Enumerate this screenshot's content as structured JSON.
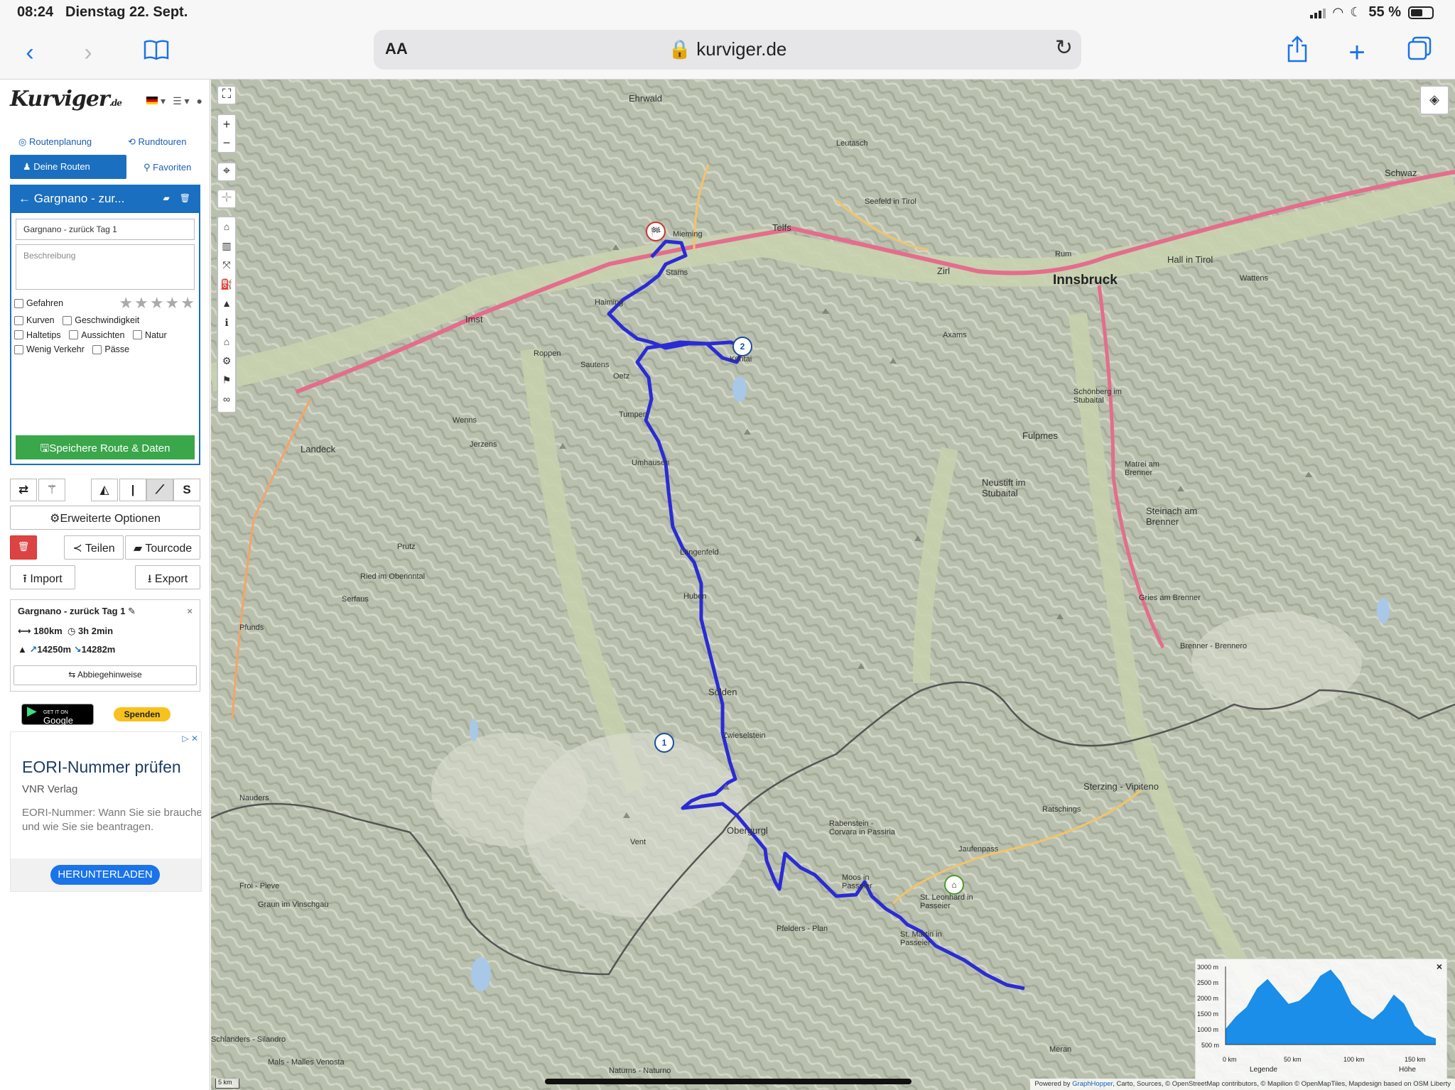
{
  "status": {
    "time": "08:24",
    "date": "Dienstag 22. Sept.",
    "battery": "55 %"
  },
  "browser": {
    "aa": "AA",
    "url": "kurviger.de"
  },
  "sidebar": {
    "logo": "Kurviger",
    "logo_suffix": ".de",
    "tabs": {
      "routenplanung": "Routenplanung",
      "rundtouren": "Rundtouren",
      "deine_routen": "Deine Routen",
      "favoriten": "Favoriten"
    },
    "route_title": "Gargnano - zur...",
    "route_name_value": "Gargnano - zurück Tag 1",
    "description_placeholder": "Beschreibung",
    "checkboxes": {
      "gefahren": "Gefahren",
      "kurven": "Kurven",
      "geschwindigkeit": "Geschwindigkeit",
      "haltetips": "Haltetips",
      "aussichten": "Aussichten",
      "natur": "Natur",
      "wenig_verkehr": "Wenig Verkehr",
      "paesse": "Pässe"
    },
    "stars": "★★★★★",
    "save_label": "Speichere Route & Daten",
    "erweiterte": "Erweiterte Optionen",
    "teilen": "Teilen",
    "tourcode": "Tourcode",
    "import": "Import",
    "export": "Export",
    "info": {
      "title": "Gargnano - zurück Tag 1",
      "distance": "180km",
      "duration": "3h 2min",
      "ascent": "14250m",
      "descent": "14282m",
      "directions": "Abbiegehinweise"
    },
    "google_play_small": "GET IT ON",
    "google_play": "Google Play",
    "spenden": "Spenden",
    "ad": {
      "title": "EORI-Nummer prüfen",
      "publisher": "VNR Verlag",
      "description": "EORI-Nummer: Wann Sie sie brauchen und wie Sie sie beantragen.",
      "cta": "HERUNTERLADEN"
    }
  },
  "map": {
    "places": {
      "innsbruck": "Innsbruck",
      "ehrwald": "Ehrwald",
      "imst": "Imst",
      "landeck": "Landeck",
      "soelden": "Sölden",
      "obergurgl": "Obergurgl",
      "zirl": "Zirl",
      "telfs": "Telfs",
      "hall": "Hall in Tirol",
      "schwaz": "Schwaz",
      "fulpmes": "Fulpmes",
      "neustift": "Neustift im Stubaital",
      "steinach": "Steinach am Brenner",
      "sterzing": "Sterzing - Vipiteno",
      "moos": "Moos in Passeier",
      "stleonhard": "St. Leonhard in Passeier",
      "stmartin": "St. Martin in Passeier",
      "laengenfeld": "Längenfeld",
      "umhausen": "Umhausen",
      "huben": "Huben",
      "oetz": "Oetz",
      "haiming": "Haiming",
      "silz": "Silz",
      "stams": "Stams",
      "mieming": "Mieming",
      "nauders": "Nauders",
      "vent": "Vent",
      "rabenstein": "Rabenstein - Corvara in Passiria",
      "seefeld": "Seefeld in Tirol",
      "mittenwald": "Leutasch",
      "schoenberg": "Schönberg im Stubaital",
      "matrei": "Matrei am Brenner",
      "gries": "Gries am Brenner",
      "brenner": "Brenner - Brennero",
      "ratschings": "Ratschings",
      "jaufen": "Jaufenpass",
      "rum": "Rum",
      "wattens": "Wattens",
      "axams": "Axams",
      "kuehtai": "Kühtai",
      "zwieselstein": "Zwieselstein",
      "tumpen": "Tumpen",
      "sautens": "Sautens",
      "roppen": "Roppen",
      "jerzens": "Jerzens",
      "wenns": "Wenns",
      "serfaus": "Serfaus",
      "prutz": "Prutz",
      "pfunds": "Pfunds",
      "ried": "Ried im Oberinntal",
      "mals": "Mals - Malles Venosta",
      "schlanders": "Schlanders - Silandro",
      "naturns": "Naturns - Naturno",
      "meran": "Meran",
      "graun": "Graun im Vinschgau",
      "froi": "Froi - Pieve",
      "ulten": "Pfelders - Plan"
    },
    "elevation": {
      "y_ticks": [
        "3000 m",
        "2500 m",
        "2000 m",
        "1500 m",
        "1000 m",
        "500 m"
      ],
      "x_ticks": [
        "0 km",
        "50 km",
        "100 km",
        "150 km"
      ],
      "legend": "Legende",
      "height": "Höhe",
      "profile_m": [
        1000,
        1400,
        1700,
        2300,
        2600,
        2200,
        1800,
        1900,
        2200,
        2700,
        2900,
        2500,
        1800,
        1500,
        1300,
        1600,
        2100,
        1800,
        1100,
        800,
        700
      ]
    },
    "attribution": {
      "powered": "Powered by ",
      "gh": "GraphHopper",
      "rest": ", Carto, Sources, © OpenStreetMap contributors, © Mapilion © OpenMapTiles, Mapdesign based on OSM Liberty"
    },
    "scale": "5 km",
    "markers": {
      "one": "1",
      "two": "2"
    }
  },
  "colors": {
    "route": "#2b2bd6",
    "brand": "#1a6fc0",
    "save": "#3aa74a",
    "danger": "#dc4444",
    "elevation": "#1a8ee8"
  }
}
